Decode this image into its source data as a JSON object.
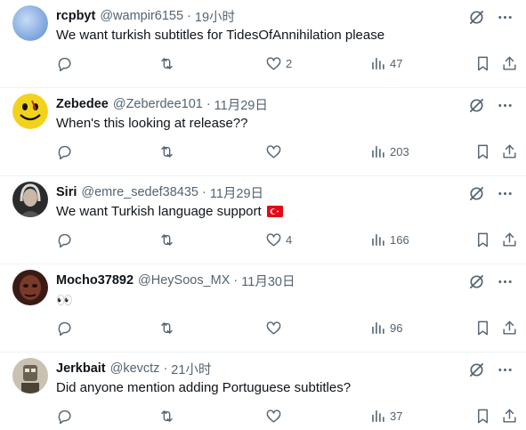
{
  "tweets": [
    {
      "name": "rcpbyt",
      "handle": "@wampir6155",
      "time": "19小时",
      "text": "We want turkish subtitles for TidesOfAnnihilation please",
      "flag": false,
      "replies": "",
      "retweets": "",
      "likes": "2",
      "views": "47",
      "avatar_color": "#8fb4e8"
    },
    {
      "name": "Zebedee",
      "handle": "@Zeberdee101",
      "time": "11月29日",
      "text": "When's this looking at release??",
      "flag": false,
      "replies": "",
      "retweets": "",
      "likes": "",
      "views": "203",
      "avatar_color": "#f2d21b"
    },
    {
      "name": "Siri",
      "handle": "@emre_sedef38435",
      "time": "11月29日",
      "text": "We want Turkish language support",
      "flag": true,
      "replies": "",
      "retweets": "",
      "likes": "4",
      "views": "166",
      "avatar_color": "#4a4a4a"
    },
    {
      "name": "Mocho37892",
      "handle": "@HeySoos_MX",
      "time": "11月30日",
      "text": "👀",
      "flag": false,
      "replies": "",
      "retweets": "",
      "likes": "",
      "views": "96",
      "avatar_color": "#5a2d22"
    },
    {
      "name": "Jerkbait",
      "handle": "@kevctz",
      "time": "21小时",
      "text": "Did anyone mention adding Portuguese subtitles?",
      "flag": false,
      "replies": "",
      "retweets": "",
      "likes": "",
      "views": "37",
      "avatar_color": "#8a7f6a"
    }
  ],
  "separator": "·",
  "colors": {
    "text": "#0f1419",
    "secondary": "#536471",
    "divider": "#eff3f4",
    "flag_red": "#e30a17"
  },
  "icons": [
    "grok-icon",
    "more-icon",
    "reply-icon",
    "retweet-icon",
    "like-icon",
    "views-icon",
    "bookmark-icon",
    "share-icon"
  ]
}
